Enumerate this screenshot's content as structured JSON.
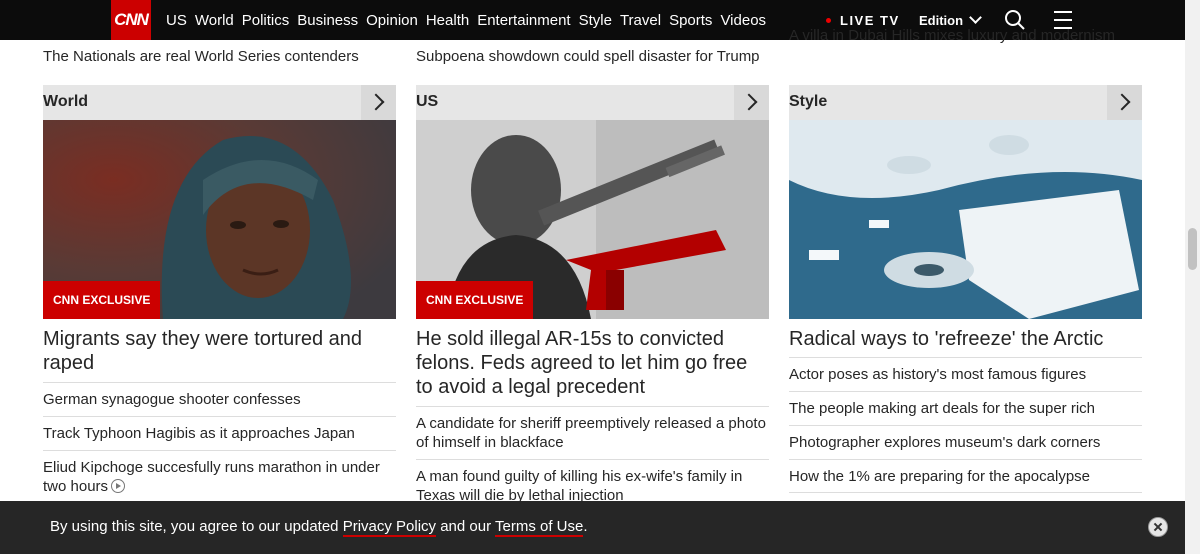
{
  "nav": {
    "logo": "CNN",
    "links": [
      "US",
      "World",
      "Politics",
      "Business",
      "Opinion",
      "Health",
      "Entertainment",
      "Style",
      "Travel",
      "Sports",
      "Videos"
    ],
    "live_tv": "LIVE TV",
    "edition": "Edition"
  },
  "columns": [
    {
      "partial_headline": "The Nationals are real World Series contenders",
      "section": "World",
      "badge": "CNN EXCLUSIVE",
      "headline": "Migrants say they were tortured and raped",
      "items": [
        "German synagogue shooter confesses",
        "Track Typhoon Hagibis as it approaches Japan",
        "Eliud Kipchoge succesfully runs marathon in under two hours"
      ]
    },
    {
      "partial_headline": "Subpoena showdown could spell disaster for Trump",
      "section": "US",
      "badge": "CNN EXCLUSIVE",
      "headline": "He sold illegal AR-15s to convicted felons. Feds agreed to let him go free to avoid a legal precedent",
      "items": [
        "A candidate for sheriff preemptively released a photo of himself in blackface",
        "A man found guilty of killing his ex-wife's family in Texas will die by lethal injection"
      ]
    },
    {
      "partial_headline": "A villa in Dubai Hills mixes luxury and modernism",
      "section": "Style",
      "headline": "Radical ways to 'refreeze' the Arctic",
      "items": [
        "Actor poses as history's most famous figures",
        "The people making art deals for the super rich",
        "Photographer explores museum's dark corners",
        "How the 1% are preparing for the apocalypse"
      ]
    }
  ],
  "cookie": {
    "prefix": "By using this site, you agree to our updated",
    "privacy": "Privacy Policy",
    "middle": "and our",
    "terms": "Terms of Use",
    "suffix": "."
  },
  "icons": [
    "search-icon",
    "menu-icon",
    "chevron-right-icon",
    "play-icon",
    "close-icon"
  ]
}
